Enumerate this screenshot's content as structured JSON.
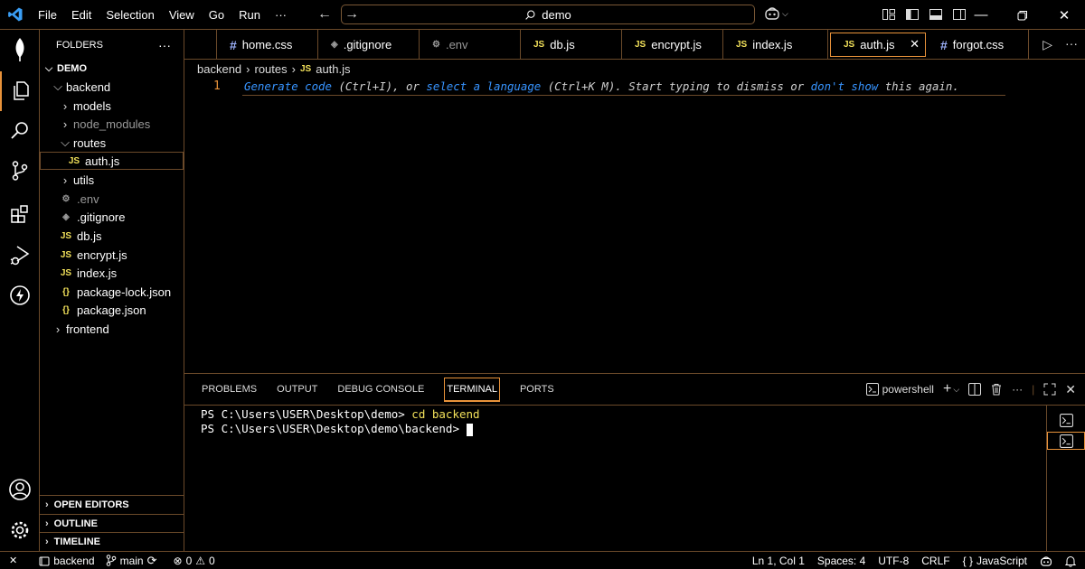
{
  "titlebar": {
    "menu": [
      "File",
      "Edit",
      "Selection",
      "View",
      "Go",
      "Run",
      "···"
    ],
    "search_text": "demo"
  },
  "sidebar": {
    "title": "FOLDERS",
    "root": "DEMO",
    "items": [
      {
        "label": "backend",
        "kind": "folder-open"
      },
      {
        "label": "models",
        "kind": "folder"
      },
      {
        "label": "node_modules",
        "kind": "folder"
      },
      {
        "label": "routes",
        "kind": "folder-open"
      },
      {
        "label": "auth.js",
        "kind": "js"
      },
      {
        "label": "utils",
        "kind": "folder"
      },
      {
        "label": ".env",
        "kind": "env"
      },
      {
        "label": ".gitignore",
        "kind": "git"
      },
      {
        "label": "db.js",
        "kind": "js"
      },
      {
        "label": "encrypt.js",
        "kind": "js"
      },
      {
        "label": "index.js",
        "kind": "js"
      },
      {
        "label": "package-lock.json",
        "kind": "json"
      },
      {
        "label": "package.json",
        "kind": "json"
      },
      {
        "label": "frontend",
        "kind": "folder"
      }
    ],
    "sections": [
      "OPEN EDITORS",
      "OUTLINE",
      "TIMELINE"
    ]
  },
  "tabs": [
    {
      "label": "home.css",
      "icon": "#"
    },
    {
      "label": ".gitignore",
      "icon": "◈"
    },
    {
      "label": ".env",
      "icon": "⚙"
    },
    {
      "label": "db.js",
      "icon": "JS"
    },
    {
      "label": "encrypt.js",
      "icon": "JS"
    },
    {
      "label": "index.js",
      "icon": "JS"
    },
    {
      "label": "auth.js",
      "icon": "JS"
    },
    {
      "label": "forgot.css",
      "icon": "#"
    }
  ],
  "breadcrumb": {
    "a": "backend",
    "b": "routes",
    "file_icon": "JS",
    "c": "auth.js"
  },
  "editor": {
    "line_number": "1",
    "hint": {
      "link1": "Generate code",
      "t1": " (Ctrl+I), or ",
      "link2": "select a language",
      "t2": " (Ctrl+K M). Start typing to dismiss or ",
      "link3": "don't show",
      "t3": " this again."
    }
  },
  "panel": {
    "tabs": [
      "PROBLEMS",
      "OUTPUT",
      "DEBUG CONSOLE",
      "TERMINAL",
      "PORTS"
    ],
    "shell": "powershell",
    "term": {
      "prompt1": "PS C:\\Users\\USER\\Desktop\\demo> ",
      "cmd1": "cd backend",
      "prompt2": "PS C:\\Users\\USER\\Desktop\\demo\\backend> "
    }
  },
  "statusbar": {
    "folder": "backend",
    "branch": "main",
    "errors": "0",
    "warnings": "0",
    "position": "Ln 1, Col 1",
    "spaces": "Spaces: 4",
    "encoding": "UTF-8",
    "eol": "CRLF",
    "language": "JavaScript"
  },
  "colors": {
    "accent": "#e8923a",
    "border": "#6b4a2a",
    "link": "#3794ff",
    "js": "#f1e05a"
  }
}
